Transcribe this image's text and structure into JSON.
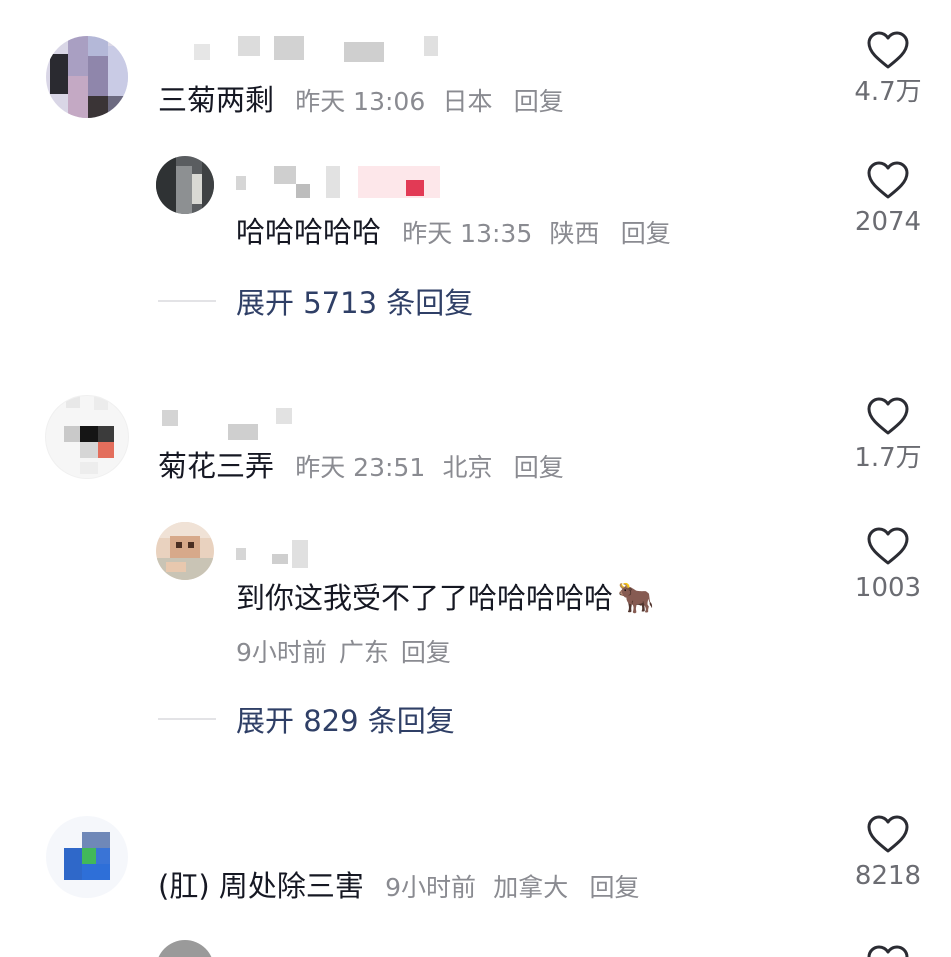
{
  "comments": [
    {
      "text": "三菊两剩",
      "time": "昨天 13:06",
      "location": "日本",
      "reply_label": "回复",
      "likes": "4.7万",
      "reply": {
        "text": "哈哈哈哈哈",
        "time": "昨天 13:35",
        "location": "陕西",
        "reply_label": "回复",
        "likes": "2074"
      },
      "expand_label": "展开 5713 条回复"
    },
    {
      "text": "菊花三弄",
      "time": "昨天 23:51",
      "location": "北京",
      "reply_label": "回复",
      "likes": "1.7万",
      "reply": {
        "text": "到你这我受不了了哈哈哈哈哈",
        "emoji": "🐂",
        "time": "9小时前",
        "location": "广东",
        "reply_label": "回复",
        "likes": "1003"
      },
      "expand_label": "展开 829 条回复"
    },
    {
      "text": "(肛) 周处除三害",
      "time": "9小时前",
      "location": "加拿大",
      "reply_label": "回复",
      "likes": "8218"
    }
  ],
  "icons": {
    "like": "heart-outline-icon"
  },
  "colors": {
    "text": "#161823",
    "meta": "#8a8b91",
    "expand": "#2f3f66",
    "like_count": "#6b6c72"
  }
}
